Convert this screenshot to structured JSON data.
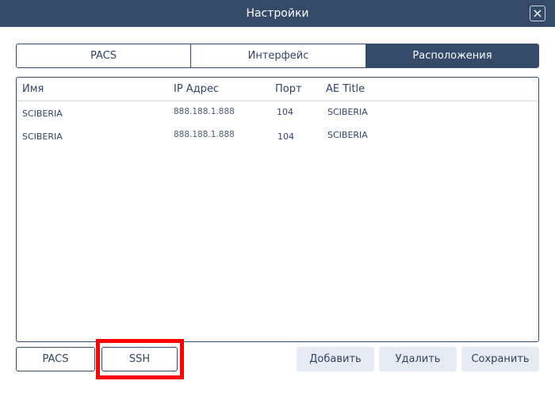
{
  "window": {
    "title": "Настройки",
    "close_icon": "×"
  },
  "tabs": [
    {
      "label": "PACS",
      "active": false
    },
    {
      "label": "Интерфейс",
      "active": false
    },
    {
      "label": "Расположения",
      "active": true
    }
  ],
  "table": {
    "columns": [
      "Имя",
      "IP Адрес",
      "Порт",
      "AE Title"
    ],
    "rows": [
      {
        "name": "SCIBERIA",
        "ip": "888.188.1.888",
        "port": "104",
        "ae_title": "SCIBERIA"
      },
      {
        "name": "SCIBERIA",
        "ip": "888.188.1.888",
        "port": "104",
        "ae_title": "SCIBERIA"
      }
    ]
  },
  "buttons": {
    "pacs": "PACS",
    "ssh": "SSH",
    "add": "Добавить",
    "delete": "Удалить",
    "save": "Сохранить"
  },
  "colors": {
    "header": "#344a68",
    "text": "#2f4462",
    "soft_button": "#e5ebf3",
    "highlight": "#ff0000"
  }
}
